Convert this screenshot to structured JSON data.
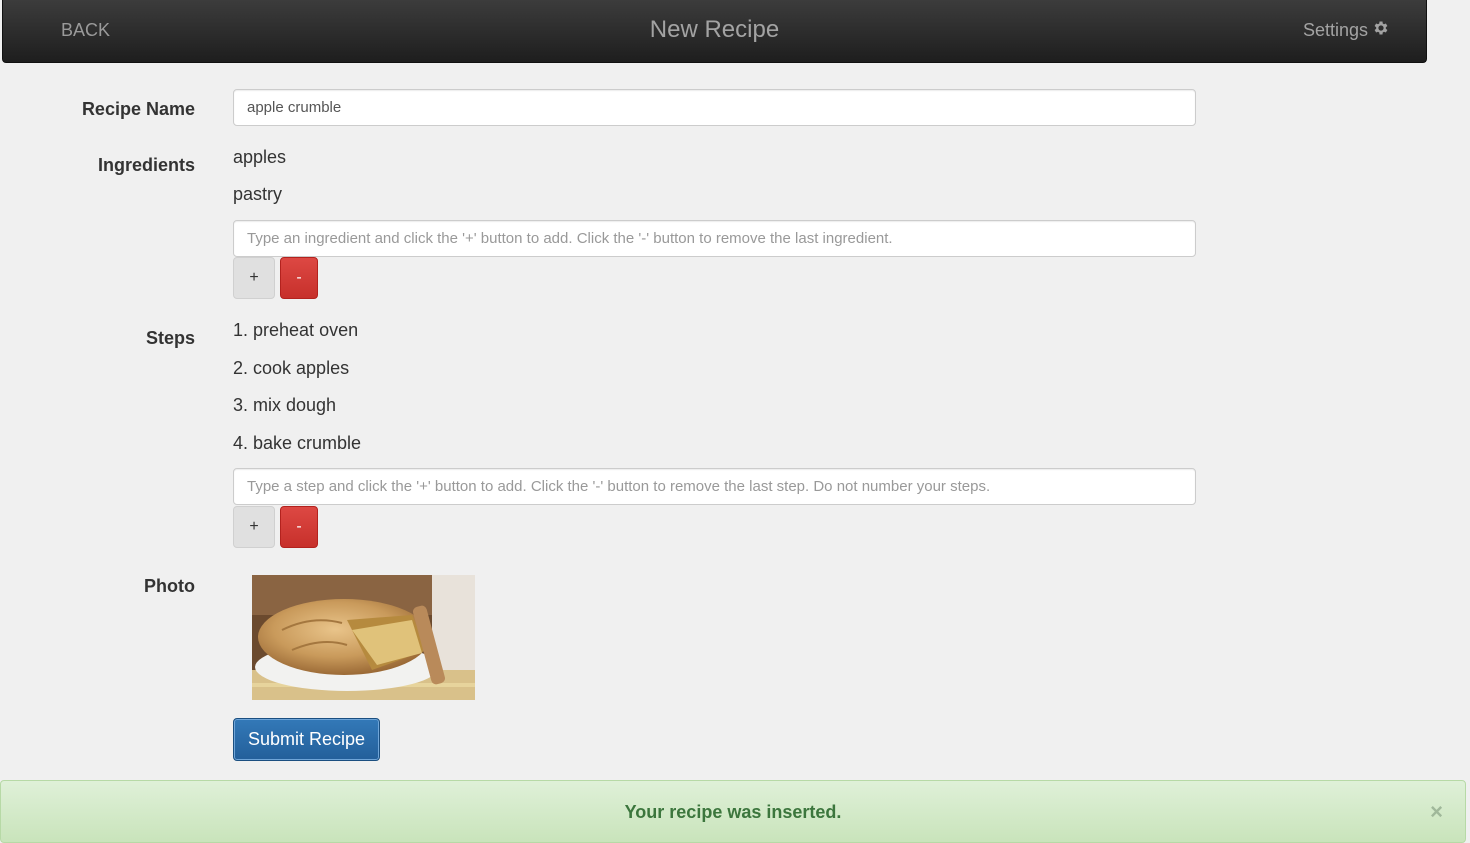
{
  "navbar": {
    "back_label": "BACK",
    "title": "New Recipe",
    "settings_label": "Settings",
    "settings_icon": "gear-icon"
  },
  "form": {
    "recipe_name_label": "Recipe Name",
    "recipe_name_value": "apple crumble",
    "ingredients_label": "Ingredients",
    "ingredients": [
      "apples",
      "pastry"
    ],
    "ingredient_placeholder": "Type an ingredient and click the '+' button to add. Click the '-' button to remove the last ingredient.",
    "steps_label": "Steps",
    "steps": [
      "1. preheat oven",
      "2. cook apples",
      "3. mix dough",
      "4. bake crumble"
    ],
    "step_placeholder": "Type a step and click the '+' button to add. Click the '-' button to remove the last step. Do not number your steps.",
    "add_label": "+",
    "remove_label": "-",
    "photo_label": "Photo",
    "submit_label": "Submit Recipe"
  },
  "alert": {
    "message": "Your recipe was inserted.",
    "close_label": "×"
  },
  "colors": {
    "accent": "#2a6aa8",
    "danger": "#d2322d",
    "success_text": "#3c763d",
    "success_bg": "#dff0d8"
  }
}
